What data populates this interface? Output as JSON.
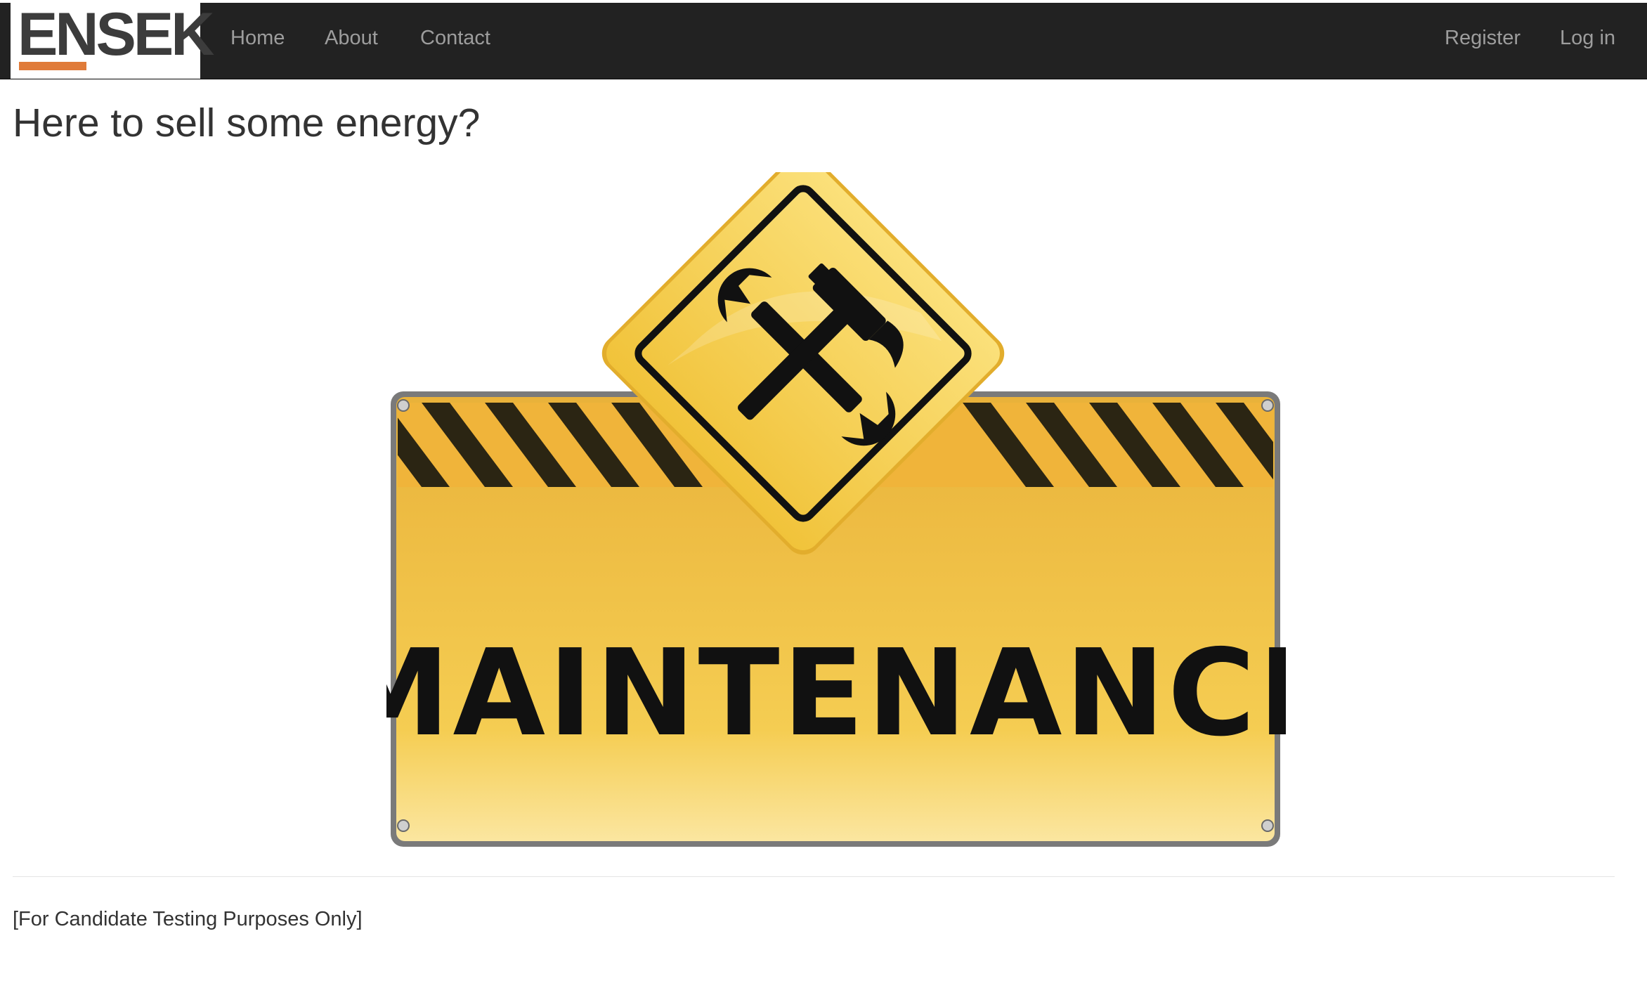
{
  "brand": {
    "logo_text": "ENSEK"
  },
  "nav": {
    "home": "Home",
    "about": "About",
    "contact": "Contact",
    "register": "Register",
    "login": "Log in"
  },
  "main": {
    "heading": "Here to sell some energy?",
    "image": {
      "sign_text": "MAINTENANCE",
      "icon": "hammer-wrench-icon"
    }
  },
  "footer": {
    "text": "[For Candidate Testing Purposes Only]"
  },
  "colors": {
    "navbar": "#222222",
    "brand_accent": "#e07b39",
    "sign_yellow": "#f2c23c",
    "stripe_dark": "#2b2513"
  }
}
